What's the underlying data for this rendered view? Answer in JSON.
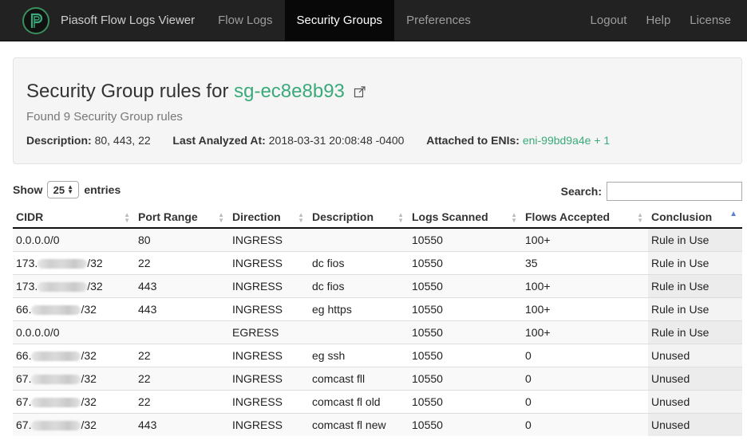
{
  "navbar": {
    "brand_title": "Piasoft Flow Logs Viewer",
    "logo_letter": "P",
    "items": [
      {
        "label": "Flow Logs"
      },
      {
        "label": "Security Groups"
      },
      {
        "label": "Preferences"
      }
    ],
    "right_items": [
      {
        "label": "Logout"
      },
      {
        "label": "Help"
      },
      {
        "label": "License"
      }
    ],
    "active": "Security Groups",
    "colors": {
      "bg": "#222222",
      "active_bg": "#080808",
      "accent": "#3aaa7a"
    }
  },
  "header": {
    "title_prefix": "Security Group rules for",
    "sg_id": "sg-ec8e8b93",
    "subtitle": "Found 9 Security Group rules",
    "description_label": "Description:",
    "description_value": "80, 443, 22",
    "last_analyzed_label": "Last Analyzed At:",
    "last_analyzed_value": "2018-03-31 20:08:48 -0400",
    "enis_label": "Attached to ENIs:",
    "enis_value": "eni-99bd9a4e + 1"
  },
  "controls": {
    "show_label": "Show",
    "entries_value": "25",
    "entries_label": "entries",
    "search_label": "Search:",
    "search_value": ""
  },
  "table": {
    "columns": [
      "CIDR",
      "Port Range",
      "Direction",
      "Description",
      "Logs Scanned",
      "Flows Accepted",
      "Conclusion"
    ],
    "sorted_column": "Conclusion",
    "rows": [
      {
        "cidr_prefix": "0.0.0.0/0",
        "cidr_suffix": "",
        "redacted": false,
        "port": "80",
        "direction": "INGRESS",
        "description": "",
        "logs": "10550",
        "flows": "100+",
        "conclusion": "Rule in Use"
      },
      {
        "cidr_prefix": "173.",
        "cidr_suffix": "/32",
        "redacted": true,
        "port": "22",
        "direction": "INGRESS",
        "description": "dc fios",
        "logs": "10550",
        "flows": "35",
        "conclusion": "Rule in Use"
      },
      {
        "cidr_prefix": "173.",
        "cidr_suffix": "/32",
        "redacted": true,
        "port": "443",
        "direction": "INGRESS",
        "description": "dc fios",
        "logs": "10550",
        "flows": "100+",
        "conclusion": "Rule in Use"
      },
      {
        "cidr_prefix": "66.",
        "cidr_suffix": "/32",
        "redacted": true,
        "port": "443",
        "direction": "INGRESS",
        "description": "eg https",
        "logs": "10550",
        "flows": "100+",
        "conclusion": "Rule in Use"
      },
      {
        "cidr_prefix": "0.0.0.0/0",
        "cidr_suffix": "",
        "redacted": false,
        "port": "",
        "direction": "EGRESS",
        "description": "",
        "logs": "10550",
        "flows": "100+",
        "conclusion": "Rule in Use"
      },
      {
        "cidr_prefix": "66.",
        "cidr_suffix": "/32",
        "redacted": true,
        "port": "22",
        "direction": "INGRESS",
        "description": "eg ssh",
        "logs": "10550",
        "flows": "0",
        "conclusion": "Unused"
      },
      {
        "cidr_prefix": "67.",
        "cidr_suffix": "/32",
        "redacted": true,
        "port": "22",
        "direction": "INGRESS",
        "description": "comcast fll",
        "logs": "10550",
        "flows": "0",
        "conclusion": "Unused"
      },
      {
        "cidr_prefix": "67.",
        "cidr_suffix": "/32",
        "redacted": true,
        "port": "22",
        "direction": "INGRESS",
        "description": "comcast fl old",
        "logs": "10550",
        "flows": "0",
        "conclusion": "Unused"
      },
      {
        "cidr_prefix": "67.",
        "cidr_suffix": "/32",
        "redacted": true,
        "port": "443",
        "direction": "INGRESS",
        "description": "comcast fl new",
        "logs": "10550",
        "flows": "0",
        "conclusion": "Unused"
      }
    ]
  }
}
